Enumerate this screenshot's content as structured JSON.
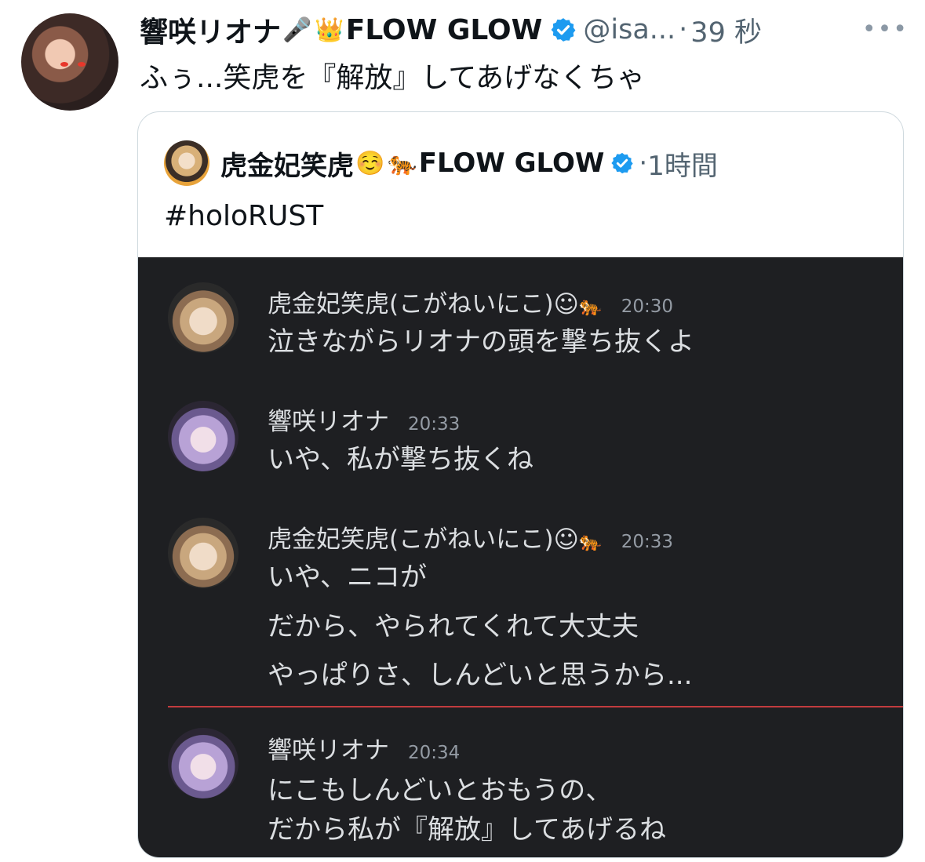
{
  "tweet": {
    "author": {
      "display_name": "響咲リオナ",
      "emoji1": "🎤",
      "emoji2": "👑",
      "name_suffix": "FLOW GLOW",
      "handle": "@isa...",
      "dot": "·",
      "timestamp": "39 秒",
      "more_label": "•••"
    },
    "text": "ふぅ...笑虎を『解放』してあげなくちゃ"
  },
  "quote": {
    "author": {
      "display_name": "虎金妃笑虎",
      "emoji1": "☺️",
      "emoji2": "🐅",
      "name_suffix": "FLOW GLOW",
      "dot": "·",
      "timestamp": "1時間"
    },
    "text": "#holoRUST",
    "chat": {
      "messages": [
        {
          "author": "虎金妃笑虎(こがねいにこ)☺",
          "emoji": "🐅",
          "time": "20:30",
          "lines": [
            "泣きながらリオナの頭を撃ち抜くよ"
          ]
        },
        {
          "author": "響咲リオナ",
          "emoji": "",
          "time": "20:33",
          "lines": [
            "いや、私が撃ち抜くね"
          ]
        },
        {
          "author": "虎金妃笑虎(こがねいにこ)☺",
          "emoji": "🐅",
          "time": "20:33",
          "lines": [
            "いや、ニコが",
            "だから、やられてくれて大丈夫",
            "やっぱりさ、しんどいと思うから..."
          ]
        },
        {
          "author": "響咲リオナ",
          "emoji": "",
          "time": "20:34",
          "lines": [
            "にこもしんどいとおもうの、",
            "だから私が『解放』してあげるね"
          ]
        }
      ]
    }
  },
  "colors": {
    "verified": "#1d9bf0",
    "chat_bg": "#1e1f22",
    "divider": "#c23b3e"
  }
}
